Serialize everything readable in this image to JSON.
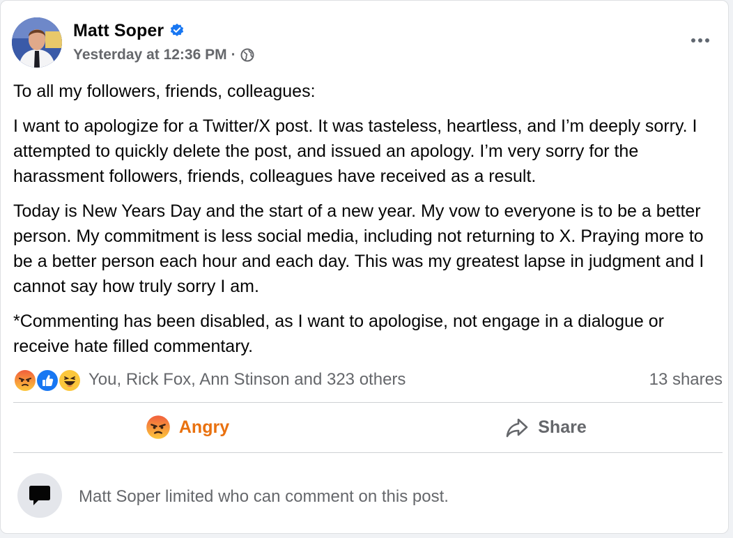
{
  "post": {
    "author": "Matt Soper",
    "timestamp": "Yesterday at 12:36 PM",
    "separator": "·",
    "audience_icon": "globe-icon",
    "verified_icon": "verified-badge-icon",
    "paragraphs": [
      "To all my followers, friends, colleagues:",
      "I want to apologize for a Twitter/X post. It was tasteless, heartless, and I’m deeply sorry. I attempted to quickly delete the post, and issued an apology. I’m very sorry for the harassment followers, friends, colleagues have received as a result.",
      "Today is New Years Day and the start of a new year. My vow to everyone is to be a better person. My commitment is less social media, including not returning to X. Praying more to be a better person each hour and each day. This was my greatest lapse in judgment and I cannot say how truly sorry I am.",
      "*Commenting has been disabled, as I want to apologise, not engage in a dialogue or receive hate filled commentary."
    ]
  },
  "reactions": {
    "icons": [
      "angry-reaction-icon",
      "like-reaction-icon",
      "haha-reaction-icon"
    ],
    "summary": "You, Rick Fox, Ann Stinson and 323 others",
    "shares": "13 shares"
  },
  "actions": {
    "reaction_label": "Angry",
    "share_label": "Share"
  },
  "comments_notice": "Matt Soper limited who can comment on this post.",
  "colors": {
    "angry_orange": "#e9710f",
    "facebook_blue": "#1877f2",
    "muted_text": "#65676b"
  }
}
